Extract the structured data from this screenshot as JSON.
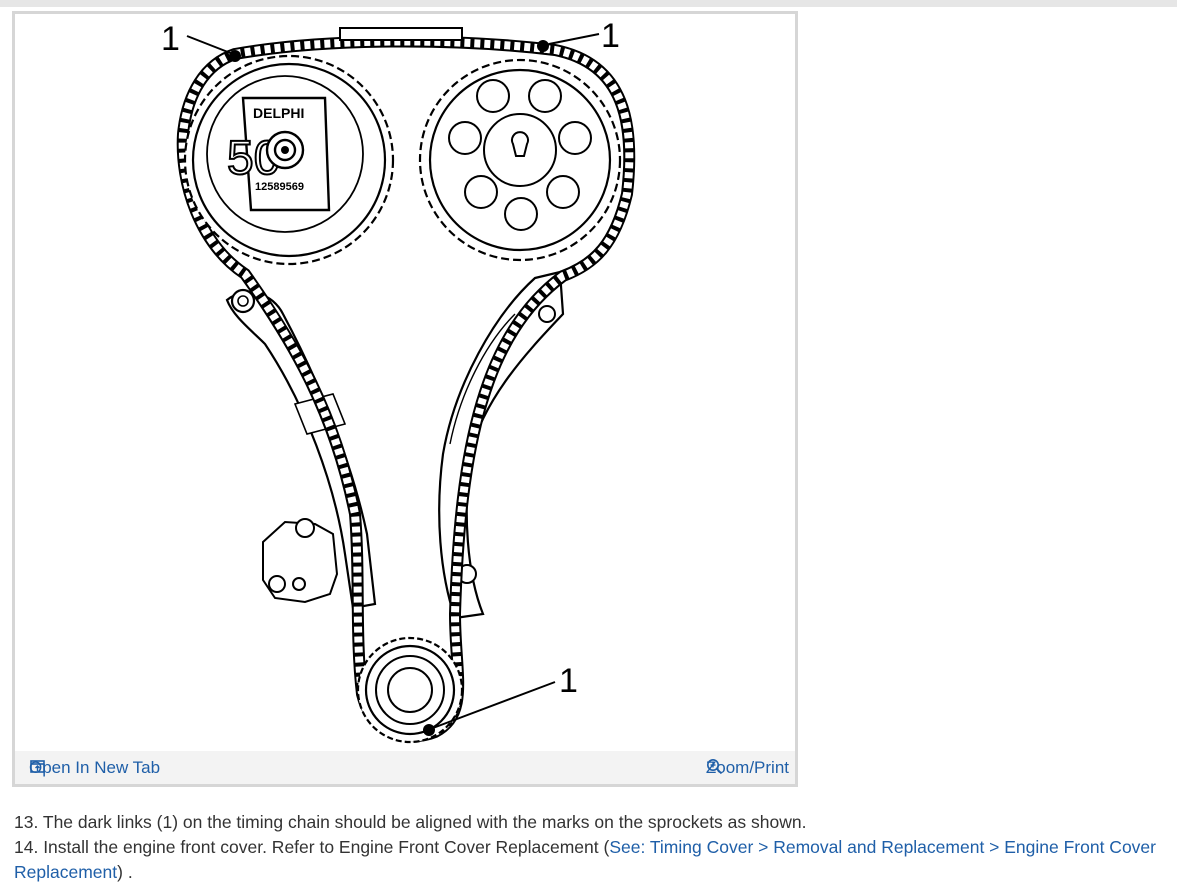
{
  "figure": {
    "callouts": [
      "1",
      "1",
      "1"
    ],
    "sprocket_brand": "DELPHI",
    "sprocket_number": "50",
    "sprocket_part": "12589569"
  },
  "toolbar": {
    "open_new_tab": "Open In New Tab",
    "zoom_print": "Zoom/Print"
  },
  "steps": {
    "step13": "13. The dark links (1) on the timing chain should be aligned with the marks on the sprockets as shown.",
    "step14_prefix": "14. Install the engine front cover. Refer to Engine Front Cover Replacement (",
    "step14_link": "See: Timing Cover > Removal and Replacement > Engine Front Cover Replacement",
    "step14_suffix": ") ."
  },
  "colors": {
    "link": "#1f5fa8",
    "text": "#333333",
    "border": "#d6d6d6"
  }
}
